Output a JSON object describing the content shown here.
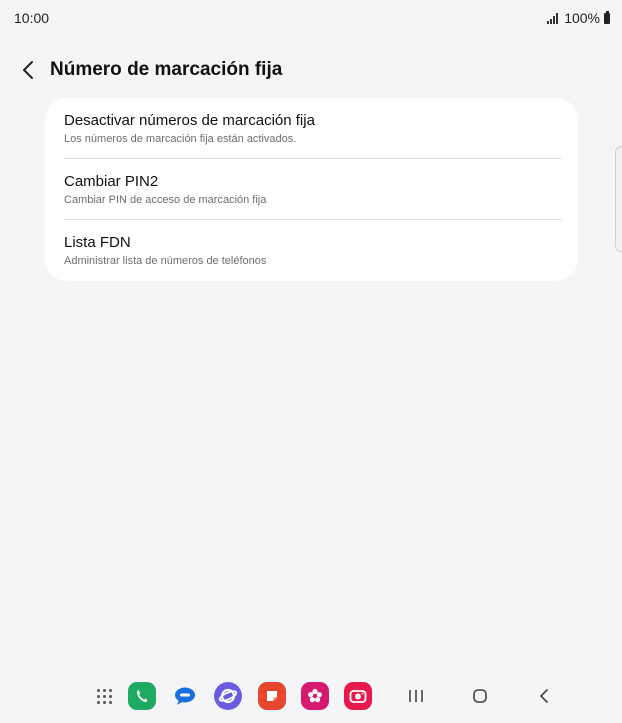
{
  "status_bar": {
    "time": "10:00",
    "battery": "100%"
  },
  "header": {
    "title": "Número de marcación fija"
  },
  "settings": {
    "items": [
      {
        "title": "Desactivar números de marcación fija",
        "subtitle": "Los números de marcación fija están activados."
      },
      {
        "title": "Cambiar PIN2",
        "subtitle": "Cambiar PIN de acceso de marcación fija"
      },
      {
        "title": "Lista FDN",
        "subtitle": "Administrar lista de números de teléfonos"
      }
    ]
  },
  "taskbar": {
    "apps": [
      {
        "name": "phone-icon",
        "color": "#1faa62"
      },
      {
        "name": "messages-icon",
        "color": "#1a6fe0"
      },
      {
        "name": "internet-icon",
        "color": "#6b5be0"
      },
      {
        "name": "notes-icon",
        "color": "#e8462e"
      },
      {
        "name": "gallery-icon",
        "color": "#d6186f"
      },
      {
        "name": "camera-icon",
        "color": "#e8194c"
      }
    ]
  }
}
